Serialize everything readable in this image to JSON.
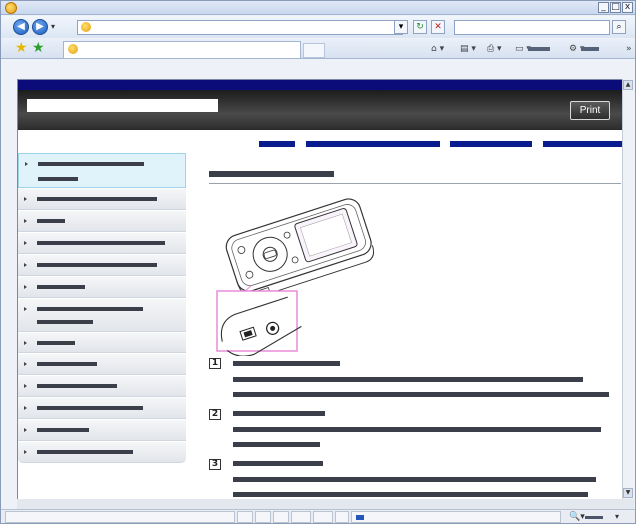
{
  "window": {
    "title_text": "",
    "controls": {
      "minimize": "_",
      "maximize": "□",
      "close": "x"
    }
  },
  "navigation": {
    "back_glyph": "◀",
    "forward_glyph": "▶",
    "dropdown_glyph": "▾",
    "address_value": "",
    "refresh_glyph": "↻",
    "stop_glyph": "✕",
    "search_value": "",
    "search_glyph": "⌕"
  },
  "favorites": {
    "star_glyph": "★",
    "add_glyph": "★",
    "tab_title": "",
    "command_glyphs": [
      "⌂ ▾",
      "▤ ▾",
      "⎙ ▾",
      "▭ ▾",
      "⚙ ▾"
    ],
    "overflow": "»"
  },
  "page": {
    "print_label": "Print",
    "numbered_items": [
      "1",
      "2",
      "3"
    ]
  },
  "statusbar": {
    "zoom_label": "🔍▾"
  },
  "colors": {
    "banner_top": "#0b0b7a",
    "nav_links": "#0a1d8f",
    "active_menu": "#e0f3fb",
    "highlight_box": "#e98bd8"
  }
}
